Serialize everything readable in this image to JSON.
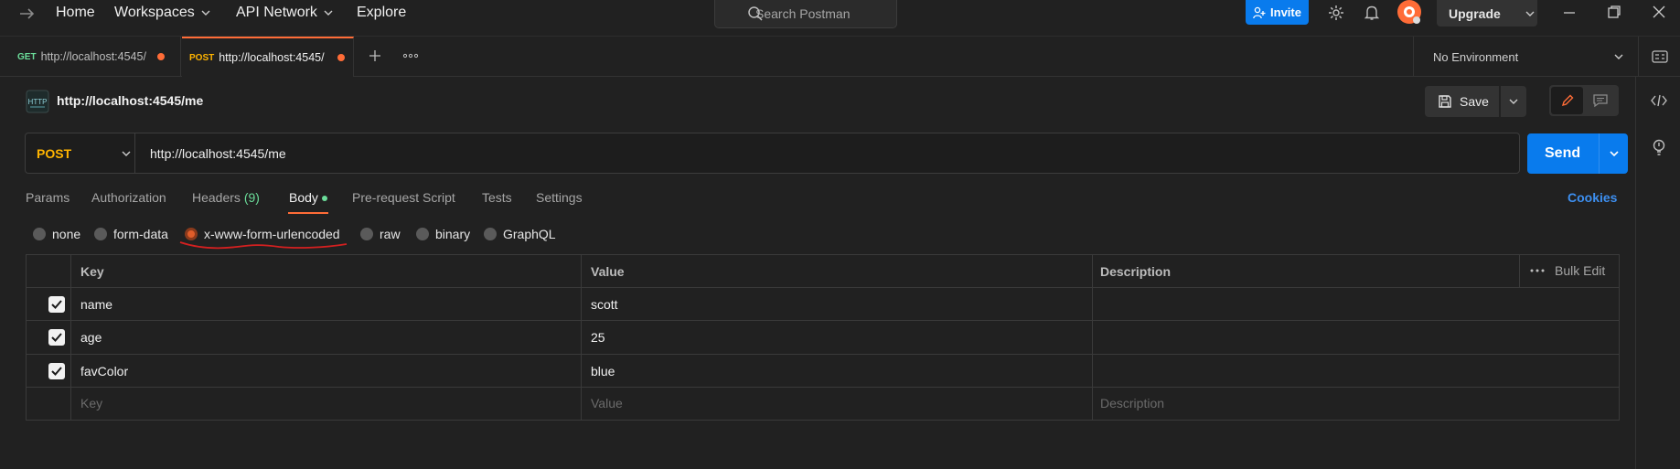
{
  "topnav": {
    "home": "Home",
    "workspaces": "Workspaces",
    "api_network": "API Network",
    "explore": "Explore",
    "search_placeholder": "Search Postman",
    "invite": "Invite",
    "upgrade": "Upgrade"
  },
  "tabs": [
    {
      "method": "GET",
      "url": "http://localhost:4545/"
    },
    {
      "method": "POST",
      "url": "http://localhost:4545/"
    }
  ],
  "environment": "No Environment",
  "request": {
    "title": "http://localhost:4545/me",
    "save": "Save",
    "method": "POST",
    "url": "http://localhost:4545/me",
    "send": "Send"
  },
  "req_tabs": {
    "params": "Params",
    "authorization": "Authorization",
    "headers": "Headers",
    "headers_count": "(9)",
    "body": "Body",
    "prerequest": "Pre-request Script",
    "tests": "Tests",
    "settings": "Settings",
    "cookies": "Cookies"
  },
  "body_types": [
    "none",
    "form-data",
    "x-www-form-urlencoded",
    "raw",
    "binary",
    "GraphQL"
  ],
  "selected_body_type": "x-www-form-urlencoded",
  "table": {
    "headers": {
      "key": "Key",
      "value": "Value",
      "description": "Description",
      "bulk_edit": "Bulk Edit"
    },
    "rows": [
      {
        "key": "name",
        "value": "scott",
        "checked": true
      },
      {
        "key": "age",
        "value": "25",
        "checked": true
      },
      {
        "key": "favColor",
        "value": "blue",
        "checked": true
      }
    ],
    "placeholders": {
      "key": "Key",
      "value": "Value",
      "description": "Description"
    }
  },
  "colors": {
    "accent": "#ff6c37",
    "brand_blue": "#097bed",
    "post": "#ffb400",
    "get": "#6bdd9a",
    "annotation_red": "#d42020"
  }
}
